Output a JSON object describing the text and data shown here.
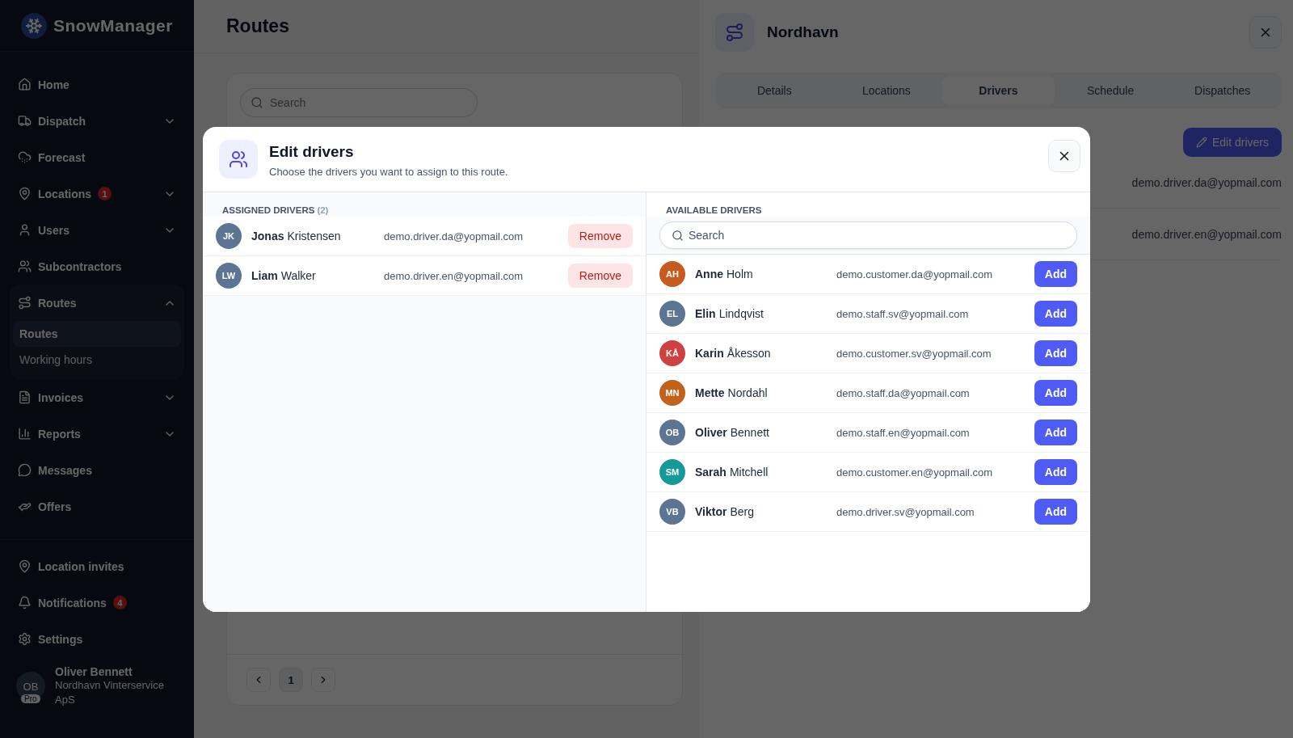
{
  "sidebar": {
    "logo": "SnowManager",
    "items": [
      {
        "label": "Home"
      },
      {
        "label": "Dispatch",
        "expanded": false
      },
      {
        "label": "Forecast"
      },
      {
        "label": "Locations",
        "badge": "1",
        "expanded": false
      },
      {
        "label": "Users",
        "expanded": false
      },
      {
        "label": "Subcontractors"
      },
      {
        "label": "Routes",
        "expanded": true,
        "children": [
          {
            "label": "Routes",
            "selected": true
          },
          {
            "label": "Working hours",
            "selected": false
          }
        ]
      },
      {
        "label": "Invoices",
        "expanded": false
      },
      {
        "label": "Reports",
        "expanded": false
      },
      {
        "label": "Messages"
      },
      {
        "label": "Offers"
      }
    ],
    "bottom_items": [
      {
        "label": "Location invites"
      },
      {
        "label": "Notifications",
        "badge": "4"
      },
      {
        "label": "Settings"
      }
    ],
    "user": {
      "initials": "OB",
      "plan": "Pro",
      "name": "Oliver Bennett",
      "company": "Nordhavn Vinterservice ApS"
    }
  },
  "routes_page": {
    "title": "Routes",
    "search": {
      "placeholder": "Search"
    },
    "pagination": {
      "pages": [
        {
          "label": "1",
          "selected": true
        }
      ]
    }
  },
  "route_detail": {
    "title": "Nordhavn",
    "tabs": [
      {
        "label": "Details",
        "selected": false
      },
      {
        "label": "Locations",
        "selected": false
      },
      {
        "label": "Drivers",
        "selected": true
      },
      {
        "label": "Schedule",
        "selected": false
      },
      {
        "label": "Dispatches",
        "selected": false
      }
    ],
    "edit_button": "Edit drivers",
    "emails": [
      "demo.driver.da@yopmail.com",
      "demo.driver.en@yopmail.com"
    ]
  },
  "modal": {
    "title": "Edit drivers",
    "subtitle": "Choose the drivers you want to assign to this route.",
    "assigned": {
      "heading": "ASSIGNED DRIVERS",
      "count": "(2)",
      "drivers": [
        {
          "initials": "JK",
          "first": "Jonas",
          "last": "Kristensen",
          "email": "demo.driver.da@yopmail.com",
          "color": "#5b7592",
          "action": "Remove"
        },
        {
          "initials": "LW",
          "first": "Liam",
          "last": "Walker",
          "email": "demo.driver.en@yopmail.com",
          "color": "#5b7592",
          "action": "Remove"
        }
      ]
    },
    "available": {
      "heading": "AVAILABLE DRIVERS",
      "search": {
        "placeholder": "Search"
      },
      "drivers": [
        {
          "initials": "AH",
          "first": "Anne",
          "last": "Holm",
          "email": "demo.customer.da@yopmail.com",
          "color": "#c95a1e",
          "action": "Add"
        },
        {
          "initials": "EL",
          "first": "Elin",
          "last": "Lindqvist",
          "email": "demo.staff.sv@yopmail.com",
          "color": "#5b7592",
          "action": "Add"
        },
        {
          "initials": "KÅ",
          "first": "Karin",
          "last": "Åkesson",
          "email": "demo.customer.sv@yopmail.com",
          "color": "#cf4040",
          "action": "Add"
        },
        {
          "initials": "MN",
          "first": "Mette",
          "last": "Nordahl",
          "email": "demo.staff.da@yopmail.com",
          "color": "#c2611a",
          "action": "Add"
        },
        {
          "initials": "OB",
          "first": "Oliver",
          "last": "Bennett",
          "email": "demo.staff.en@yopmail.com",
          "color": "#5b7592",
          "action": "Add"
        },
        {
          "initials": "SM",
          "first": "Sarah",
          "last": "Mitchell",
          "email": "demo.customer.en@yopmail.com",
          "color": "#16999a",
          "action": "Add"
        },
        {
          "initials": "VB",
          "first": "Viktor",
          "last": "Berg",
          "email": "demo.driver.sv@yopmail.com",
          "color": "#5b7592",
          "action": "Add"
        }
      ]
    }
  }
}
